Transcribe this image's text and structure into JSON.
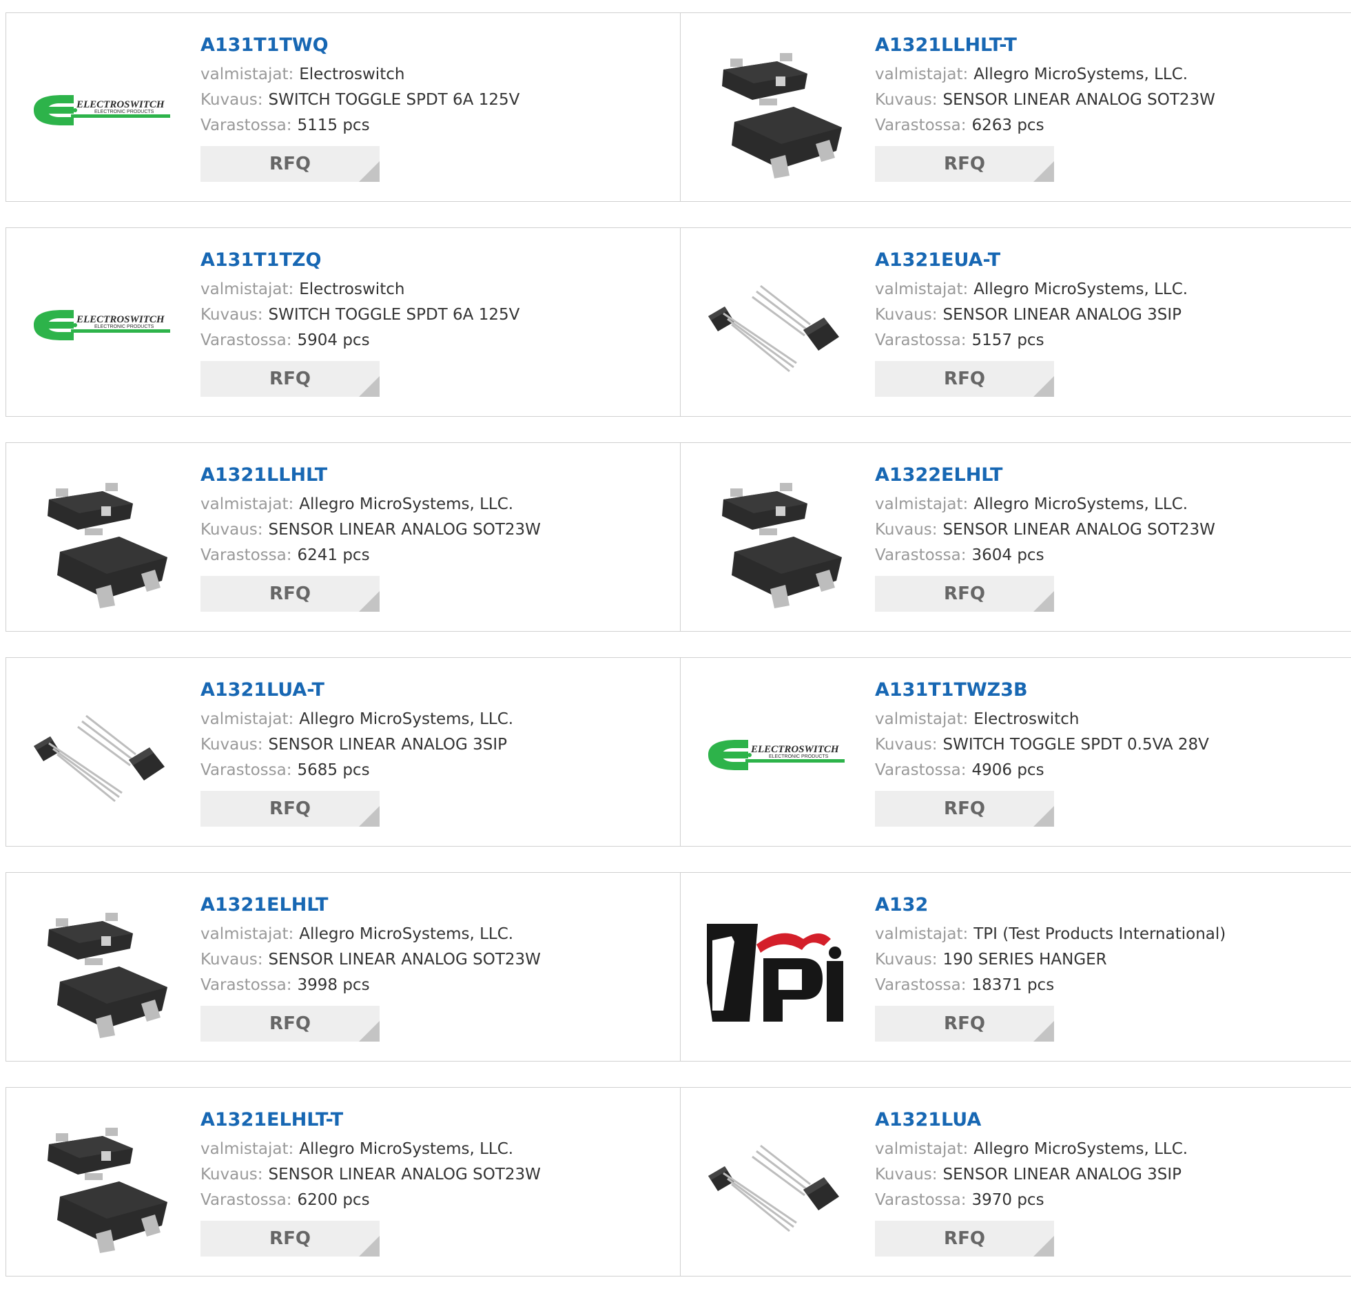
{
  "labels": {
    "manufacturer": "valmistajat:",
    "description": "Kuvaus:",
    "stock": "Varastossa:",
    "rfq": "RFQ"
  },
  "products": [
    {
      "part": "A131T1TWQ",
      "manufacturer": "Electroswitch",
      "description": "SWITCH TOGGLE SPDT 6A 125V",
      "stock": "5115 pcs",
      "image": "electroswitch-logo",
      "logo_text": "ELECTROSWITCH",
      "logo_sub": "ELECTRONIC PRODUCTS"
    },
    {
      "part": "A1321LLHLT-T",
      "manufacturer": "Allegro MicroSystems, LLC.",
      "description": "SENSOR LINEAR ANALOG SOT23W",
      "stock": "6263 pcs",
      "image": "sot23-package"
    },
    {
      "part": "A131T1TZQ",
      "manufacturer": "Electroswitch",
      "description": "SWITCH TOGGLE SPDT 6A 125V",
      "stock": "5904 pcs",
      "image": "electroswitch-logo",
      "logo_text": "ELECTROSWITCH",
      "logo_sub": "ELECTRONIC PRODUCTS"
    },
    {
      "part": "A1321EUA-T",
      "manufacturer": "Allegro MicroSystems, LLC.",
      "description": "SENSOR LINEAR ANALOG 3SIP",
      "stock": "5157 pcs",
      "image": "sip3-package"
    },
    {
      "part": "A1321LLHLT",
      "manufacturer": "Allegro MicroSystems, LLC.",
      "description": "SENSOR LINEAR ANALOG SOT23W",
      "stock": "6241 pcs",
      "image": "sot23-package"
    },
    {
      "part": "A1322ELHLT",
      "manufacturer": "Allegro MicroSystems, LLC.",
      "description": "SENSOR LINEAR ANALOG SOT23W",
      "stock": "3604 pcs",
      "image": "sot23-package"
    },
    {
      "part": "A1321LUA-T",
      "manufacturer": "Allegro MicroSystems, LLC.",
      "description": "SENSOR LINEAR ANALOG 3SIP",
      "stock": "5685 pcs",
      "image": "sip3-package"
    },
    {
      "part": "A131T1TWZ3B",
      "manufacturer": "Electroswitch",
      "description": "SWITCH TOGGLE SPDT 0.5VA 28V",
      "stock": "4906 pcs",
      "image": "electroswitch-logo",
      "logo_text": "ELECTROSWITCH",
      "logo_sub": "ELECTRONIC PRODUCTS"
    },
    {
      "part": "A1321ELHLT",
      "manufacturer": "Allegro MicroSystems, LLC.",
      "description": "SENSOR LINEAR ANALOG SOT23W",
      "stock": "3998 pcs",
      "image": "sot23-package"
    },
    {
      "part": "A132",
      "manufacturer": "TPI (Test Products International)",
      "description": "190 SERIES HANGER",
      "stock": "18371 pcs",
      "image": "tpi-logo",
      "logo_text": "tpi"
    },
    {
      "part": "A1321ELHLT-T",
      "manufacturer": "Allegro MicroSystems, LLC.",
      "description": "SENSOR LINEAR ANALOG SOT23W",
      "stock": "6200 pcs",
      "image": "sot23-package"
    },
    {
      "part": "A1321LUA",
      "manufacturer": "Allegro MicroSystems, LLC.",
      "description": "SENSOR LINEAR ANALOG 3SIP",
      "stock": "3970 pcs",
      "image": "sip3-package"
    }
  ],
  "colors": {
    "link": "#1767b3",
    "label": "#999999",
    "value": "#333333",
    "button_bg": "#eeeeee",
    "button_text": "#666666",
    "electroswitch_green": "#2db34a",
    "tpi_red": "#d41f2a"
  }
}
